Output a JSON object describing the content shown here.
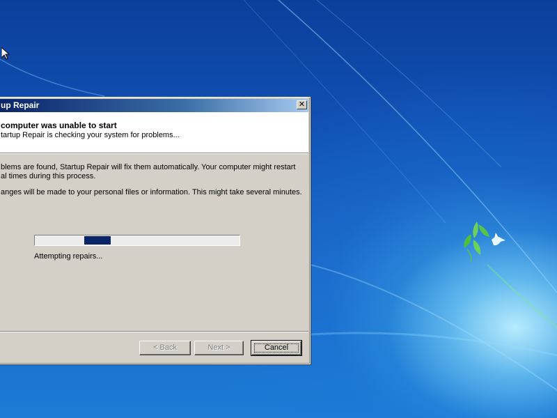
{
  "wallpaper": {
    "description": "windows-7-desktop-background",
    "logo": "windows-bird-leaf-logo",
    "colors": {
      "sky": "#1153b6",
      "glow": "#bef0ff",
      "leaf": "#5cc84a"
    }
  },
  "dialog": {
    "title": "up Repair",
    "close_label": "✕",
    "header": {
      "title": "computer was unable to start",
      "subtitle": "tartup Repair is checking your system for problems..."
    },
    "body": {
      "line1": "blems are found, Startup Repair will fix them automatically. Your computer might restart",
      "line2": "al times during this process.",
      "line3": "anges will be made to your personal files or information. This might take several minutes."
    },
    "progress": {
      "value_fraction_start": 0.24,
      "value_fraction_end": 0.37,
      "style": "marquee",
      "color": "#0a246a"
    },
    "status_text": "Attempting repairs...",
    "buttons": {
      "back": {
        "label": "< Back",
        "enabled": false
      },
      "next": {
        "label": "Next >",
        "enabled": false
      },
      "cancel": {
        "label": "Cancel",
        "enabled": true
      }
    }
  },
  "cursor": "arrow-cursor-icon"
}
